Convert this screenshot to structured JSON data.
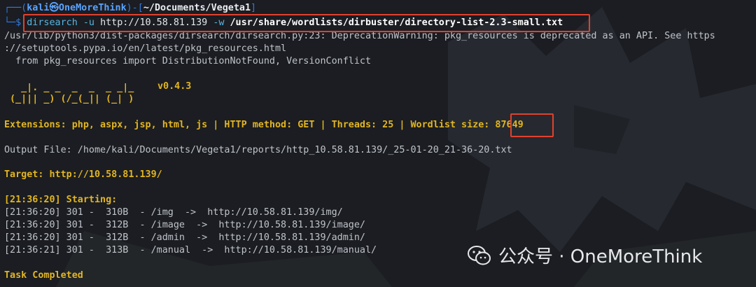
{
  "prompt": {
    "top_left": "┌──(",
    "user_host": "kali㉿OneMoreThink",
    "mid": ")-[",
    "cwd": "~/Documents/Vegeta1",
    "close": "]",
    "bottom_left": "└─$ "
  },
  "command": {
    "program": "dirsearch",
    "flag_u": "-u",
    "url": "http://10.58.81.139",
    "flag_w": "-w",
    "wordlist": "/usr/share/wordlists/dirbuster/directory-list-2.3-small.txt"
  },
  "warning_lines": [
    "/usr/lib/python3/dist-packages/dirsearch/dirsearch.py:23: DeprecationWarning: pkg_resources is deprecated as an API. See https",
    "://setuptools.pypa.io/en/latest/pkg_resources.html",
    "  from pkg_resources import DistributionNotFound, VersionConflict"
  ],
  "banner": {
    "ascii_line1": "  _|. _ _  _  _  _ _|_",
    "ascii_line2": "(_||| _) (/_(_|| (_| )",
    "version": "v0.4.3"
  },
  "config": {
    "extensions_label": "Extensions:",
    "extensions": "php, aspx, jsp, html, js",
    "sep": "|",
    "method_label": "HTTP method:",
    "method": "GET",
    "threads_label": "Threads:",
    "threads": "25",
    "wordlist_label": "Wordlist size:",
    "wordlist_size": "87649"
  },
  "output_file": "Output File: /home/kali/Documents/Vegeta1/reports/http_10.58.81.139/_25-01-20_21-36-20.txt",
  "target_label": "Target:",
  "target": "http://10.58.81.139/",
  "starting": "[21:36:20] Starting:",
  "results": [
    "[21:36:20] 301 -  310B  - /img  ->  http://10.58.81.139/img/",
    "[21:36:20] 301 -  312B  - /image  ->  http://10.58.81.139/image/",
    "[21:36:20] 301 -  312B  - /admin  ->  http://10.58.81.139/admin/",
    "[21:36:21] 301 -  313B  - /manual  ->  http://10.58.81.139/manual/"
  ],
  "completed": "Task Completed",
  "watermark": "公众号 · OneMoreThink",
  "colors": {
    "background": "#1b1d22",
    "highlight_box": "#e0412f",
    "banner_yellow": "#e2b521"
  }
}
